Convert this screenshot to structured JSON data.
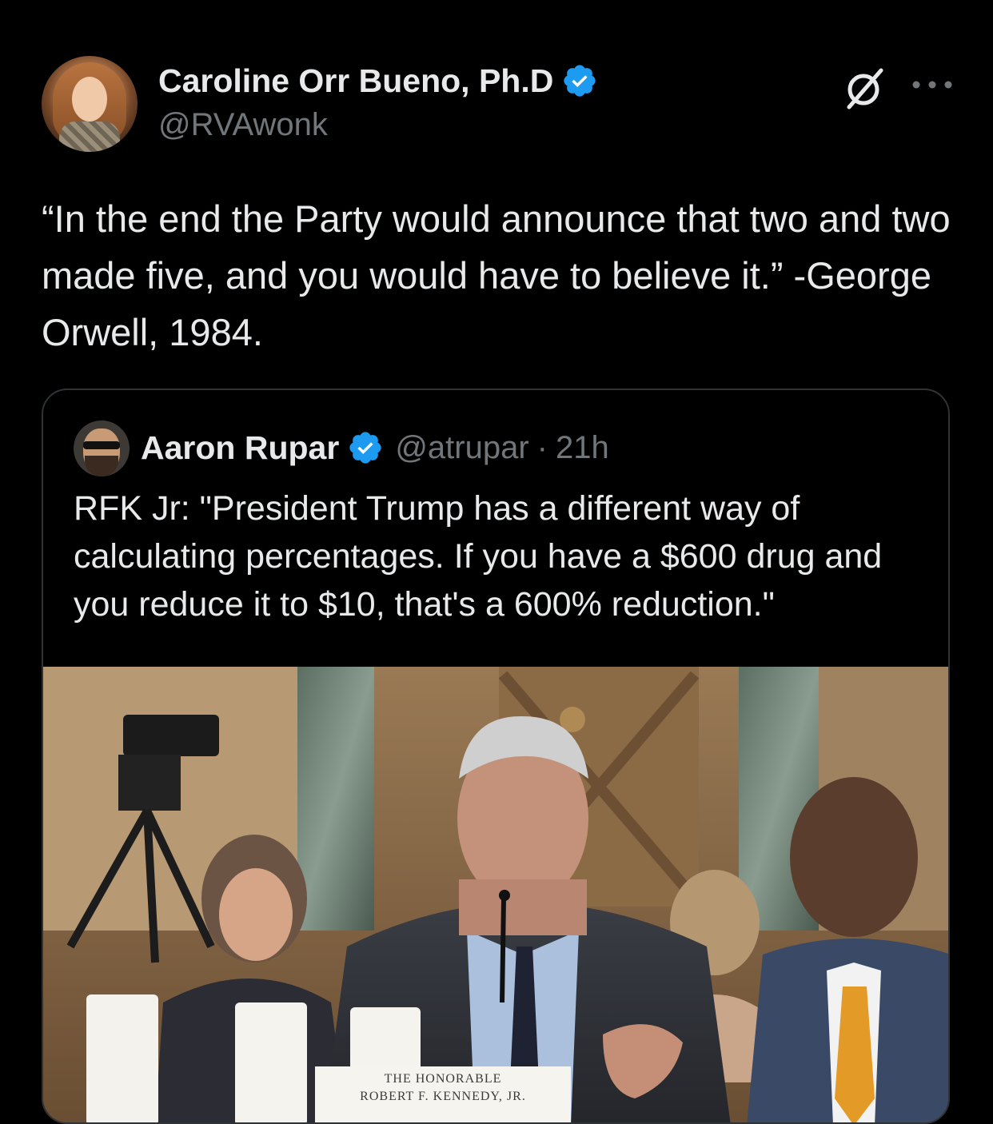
{
  "colors": {
    "background": "#000000",
    "text_primary": "#e7e9ea",
    "text_secondary": "#71767b",
    "verified_blue": "#1d9bf0",
    "border": "#2f3336"
  },
  "post": {
    "author_name": "Caroline Orr Bueno, Ph.D",
    "author_handle": "@RVAwonk",
    "verified_icon": "verified-badge-icon",
    "grok_icon": "grok-icon",
    "more_icon": "more-options-icon",
    "text": "“In the end the Party would announce that two and two made five, and you would have to believe it.” -George Orwell, 1984."
  },
  "quoted": {
    "author_name": "Aaron Rupar",
    "author_handle": "@atrupar",
    "separator": "·",
    "time": "21h",
    "text": "RFK Jr: \"President Trump has a different way of calculating percentages. If you have a $600 drug and you reduce it to $10, that's a 600% reduction.\"",
    "media": {
      "nameplate_line1": "THE HONORABLE",
      "nameplate_line2": "ROBERT F. KENNEDY, JR."
    }
  }
}
